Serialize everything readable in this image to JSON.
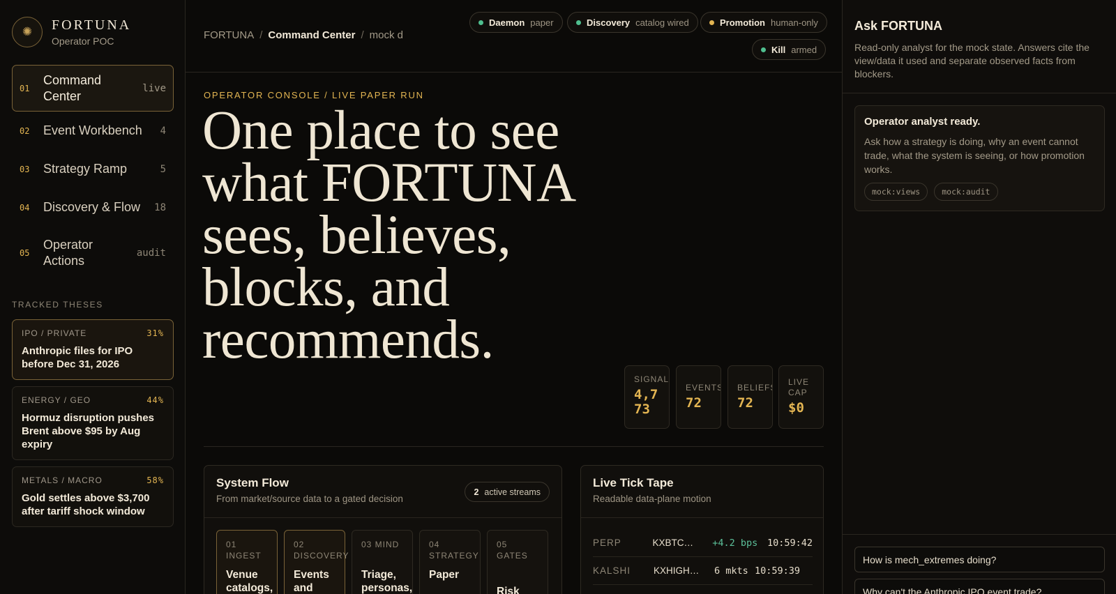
{
  "brand": {
    "name": "FORTUNA",
    "subtitle": "Operator POC"
  },
  "nav": [
    {
      "num": "01",
      "label": "Command Center",
      "count": "live",
      "active": true
    },
    {
      "num": "02",
      "label": "Event Workbench",
      "count": "4"
    },
    {
      "num": "03",
      "label": "Strategy Ramp",
      "count": "5"
    },
    {
      "num": "04",
      "label": "Discovery & Flow",
      "count": "18"
    },
    {
      "num": "05",
      "label": "Operator Actions",
      "count": "audit"
    }
  ],
  "theses": {
    "heading": "TRACKED THESES",
    "items": [
      {
        "category": "IPO / PRIVATE",
        "pct": "31%",
        "title": "Anthropic files for IPO before Dec 31, 2026"
      },
      {
        "category": "ENERGY / GEO",
        "pct": "44%",
        "title": "Hormuz disruption pushes Brent above $95 by Aug expiry"
      },
      {
        "category": "METALS / MACRO",
        "pct": "58%",
        "title": "Gold settles above $3,700 after tariff shock window"
      }
    ]
  },
  "breadcrumb": {
    "root": "FORTUNA",
    "current": "Command Center",
    "tail": "mock d"
  },
  "status": [
    {
      "key": "Daemon",
      "value": "paper",
      "color": "#4fbf8f"
    },
    {
      "key": "Discovery",
      "value": "catalog wired",
      "color": "#4fbf8f"
    },
    {
      "key": "Promotion",
      "value": "human-only",
      "color": "#e3b552"
    },
    {
      "key": "Kill",
      "value": "armed",
      "color": "#4fbf8f"
    }
  ],
  "hero": {
    "eyebrow": "OPERATOR CONSOLE / LIVE PAPER RUN",
    "headline": "One place to see what FORTUNA sees, believes, blocks, and recommends."
  },
  "stats": [
    {
      "label": "SIGNALS",
      "value": "4,773"
    },
    {
      "label": "EVENTS",
      "value": "72"
    },
    {
      "label": "BELIEFS",
      "value": "72"
    },
    {
      "label": "LIVE CAP",
      "value": "$0"
    }
  ],
  "system_flow": {
    "title": "System Flow",
    "subtitle": "From market/source data to a gated decision",
    "streams_count": "2",
    "streams_label": "active streams",
    "steps": [
      {
        "num": "01 INGEST",
        "title": "Venue catalogs, RSS,"
      },
      {
        "num": "02 DISCOVERY",
        "title": "Events and"
      },
      {
        "num": "03 MIND",
        "title": "Triage, personas,"
      },
      {
        "num": "04 STRATEGY",
        "title": "Paper"
      },
      {
        "num": "05 GATES",
        "title": "Risk board"
      }
    ]
  },
  "tick_tape": {
    "title": "Live Tick Tape",
    "subtitle": "Readable data-plane motion",
    "rows": [
      {
        "kind": "PERP",
        "symbol": "KXBTC…",
        "value": "+4.2 bps",
        "time": "10:59:42",
        "up": true
      },
      {
        "kind": "KALSHI",
        "symbol": "KXHIGHN…",
        "value": "6 mkts",
        "time": "10:59:39",
        "up": false
      }
    ]
  },
  "ask": {
    "title": "Ask FORTUNA",
    "description": "Read-only analyst for the mock state. Answers cite the view/data it used and separate observed facts from blockers.",
    "card_title": "Operator analyst ready.",
    "card_text": "Ask how a strategy is doing, why an event cannot trade, what the system is seeing, or how promotion works.",
    "tags": [
      "mock:views",
      "mock:audit"
    ],
    "suggestions": [
      "How is mech_extremes doing?",
      "Why can't the Anthropic IPO event trade?"
    ]
  }
}
